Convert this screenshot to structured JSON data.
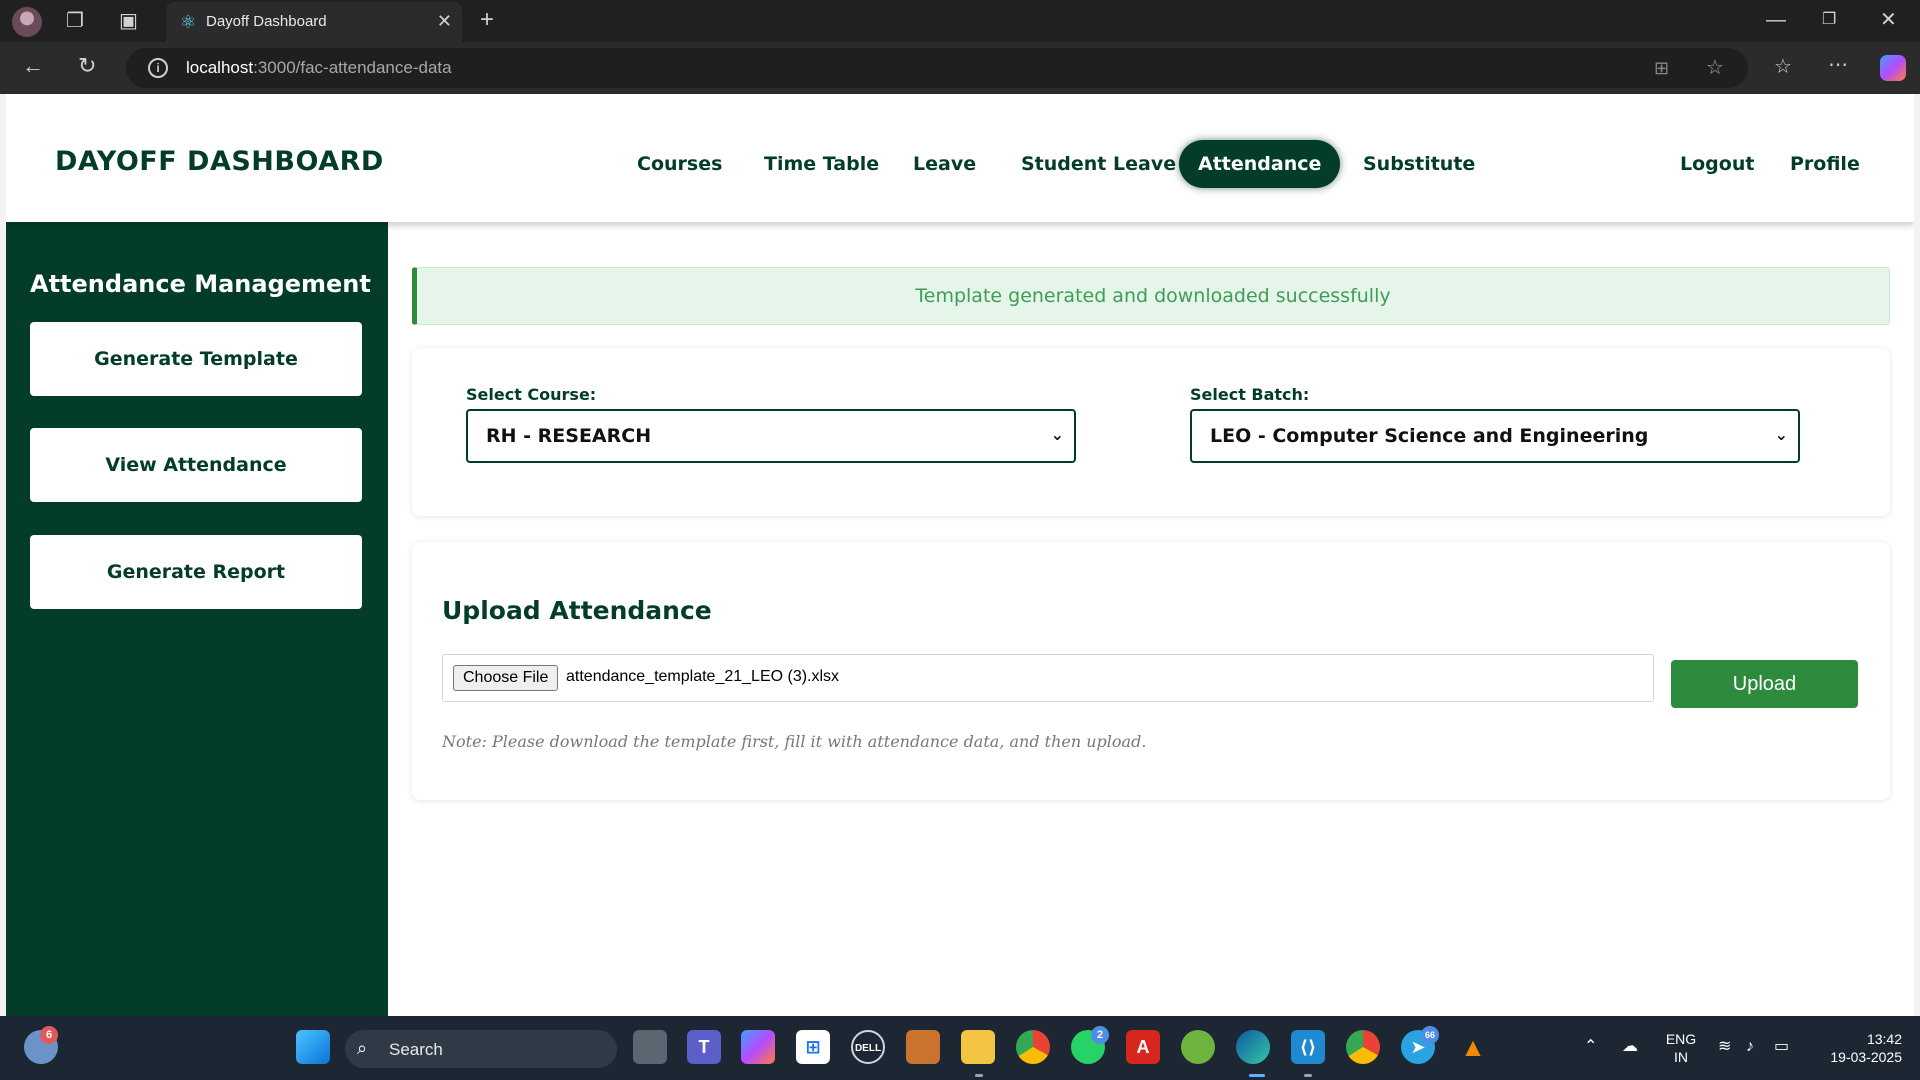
{
  "browser": {
    "tab_title": "Dayoff Dashboard",
    "url_host": "localhost",
    "url_path": ":3000/fac-attendance-data"
  },
  "navbar": {
    "brand": "DAYOFF DASHBOARD",
    "items": [
      {
        "label": "Courses"
      },
      {
        "label": "Time Table"
      },
      {
        "label": "Leave"
      },
      {
        "label": "Student Leave"
      },
      {
        "label": "Attendance",
        "active": true
      },
      {
        "label": "Substitute"
      }
    ],
    "right_items": [
      {
        "label": "Logout"
      },
      {
        "label": "Profile"
      }
    ]
  },
  "sidebar": {
    "title": "Attendance Management",
    "buttons": [
      {
        "label": "Generate Template"
      },
      {
        "label": "View Attendance"
      },
      {
        "label": "Generate Report"
      }
    ]
  },
  "main": {
    "alert": "Template generated and downloaded successfully",
    "course": {
      "label": "Select Course:",
      "value": "RH - RESEARCH"
    },
    "batch": {
      "label": "Select Batch:",
      "value": "LEO - Computer Science and Engineering"
    },
    "upload": {
      "title": "Upload Attendance",
      "choose_label": "Choose File",
      "file_name": "attendance_template_21_LEO (3).xlsx",
      "button_label": "Upload",
      "note": "Note: Please download the template first, fill it with attendance data, and then upload."
    }
  },
  "taskbar": {
    "search_label": "Search",
    "weather_badge": "6",
    "whatsapp_badge": "2",
    "telegram_badge": "66",
    "lang": "ENG",
    "region": "IN",
    "time": "13:42",
    "date": "19-03-2025"
  },
  "colors": {
    "brand_dark_green": "#033d2a",
    "success_green": "#2e8b3e",
    "alert_bg": "#e5f5e9"
  }
}
